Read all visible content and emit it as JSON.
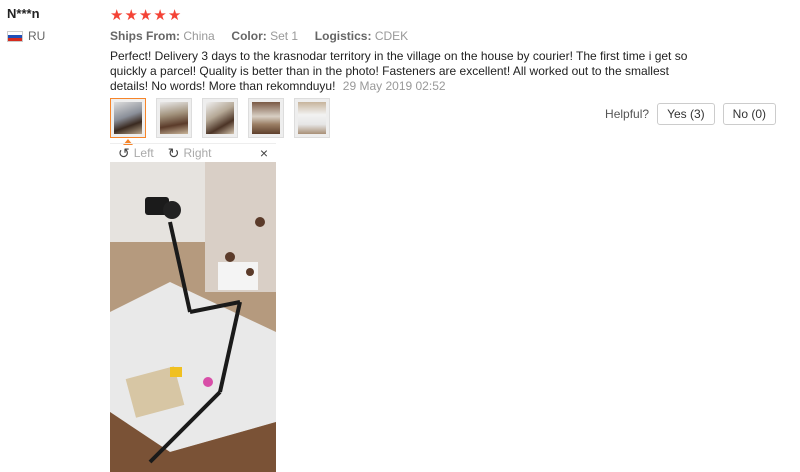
{
  "user": {
    "name": "N***n",
    "country": "RU",
    "flag_colors": [
      "#ffffff",
      "#1f4fb8",
      "#d52b1e"
    ]
  },
  "review": {
    "stars": 5,
    "ships_from_label": "Ships From:",
    "ships_from_value": "China",
    "color_label": "Color:",
    "color_value": "Set 1",
    "logistics_label": "Logistics:",
    "logistics_value": "CDEK",
    "text": "Perfect! Delivery 3 days to the krasnodar territory in the village on the house by courier! The first time i get so quickly a parcel! Quality is better than in the photo! Fasteners are excellent! All worked out to the smallest details! No words! More than rekomnduyu!",
    "date": "29 May 2019 02:52"
  },
  "helpful": {
    "label": "Helpful?",
    "yes_label": "Yes (3)",
    "no_label": "No (0)"
  },
  "viewer": {
    "rotate_left_label": "Left",
    "rotate_right_label": "Right",
    "close_glyph": "×",
    "rotate_left_glyph": "↺",
    "rotate_right_glyph": "↻"
  },
  "thumbnails": 5,
  "accent_color": "#f6852a",
  "star_color": "#f44336"
}
